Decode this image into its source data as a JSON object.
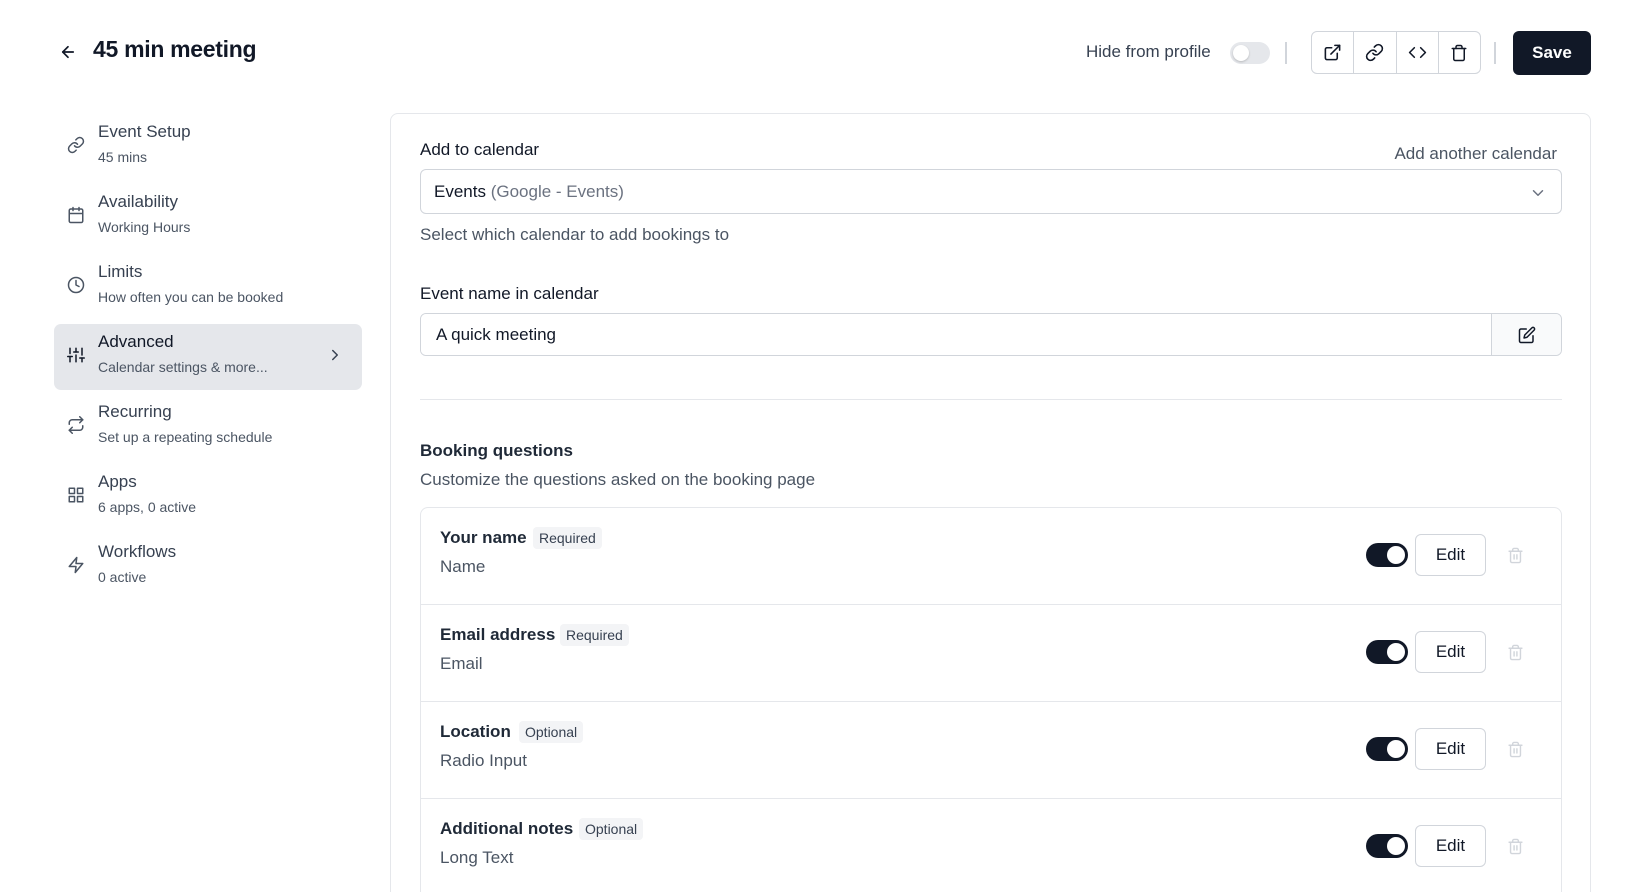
{
  "header": {
    "title": "45 min meeting",
    "hide_from_profile_label": "Hide from profile",
    "save_label": "Save"
  },
  "sidebar": {
    "items": [
      {
        "title": "Event Setup",
        "subtitle": "45 mins",
        "icon": "link-icon"
      },
      {
        "title": "Availability",
        "subtitle": "Working Hours",
        "icon": "calendar-icon"
      },
      {
        "title": "Limits",
        "subtitle": "How often you can be booked",
        "icon": "clock-icon"
      },
      {
        "title": "Advanced",
        "subtitle": "Calendar settings & more...",
        "icon": "sliders-icon",
        "active": true
      },
      {
        "title": "Recurring",
        "subtitle": "Set up a repeating schedule",
        "icon": "repeat-icon"
      },
      {
        "title": "Apps",
        "subtitle": "6 apps, 0 active",
        "icon": "grid-icon"
      },
      {
        "title": "Workflows",
        "subtitle": "0 active",
        "icon": "zap-icon"
      }
    ]
  },
  "calendar": {
    "label": "Add to calendar",
    "add_another": "Add another calendar",
    "selected": "Events",
    "selected_sub": "(Google - Events)",
    "helper": "Select which calendar to add bookings to"
  },
  "event_name": {
    "label": "Event name in calendar",
    "value": "A quick meeting"
  },
  "booking_questions": {
    "title": "Booking questions",
    "subtitle": "Customize the questions asked on the booking page",
    "edit_label": "Edit",
    "items": [
      {
        "label": "Your name",
        "badge": "Required",
        "type": "Name",
        "enabled": true
      },
      {
        "label": "Email address",
        "badge": "Required",
        "type": "Email",
        "enabled": true
      },
      {
        "label": "Location",
        "badge": "Optional",
        "type": "Radio Input",
        "enabled": true
      },
      {
        "label": "Additional notes",
        "badge": "Optional",
        "type": "Long Text",
        "enabled": true
      }
    ]
  }
}
